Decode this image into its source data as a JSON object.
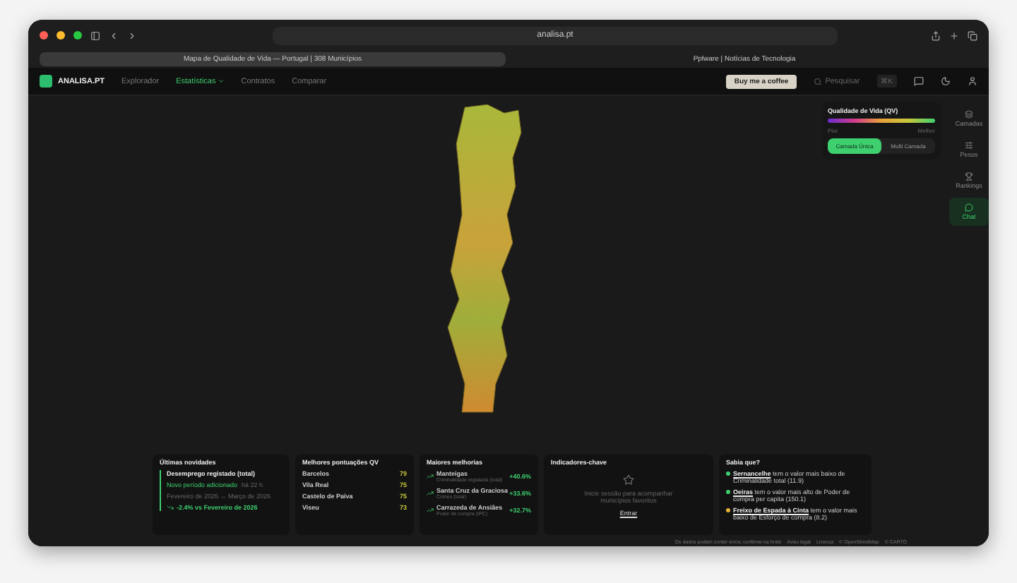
{
  "browser": {
    "address": "analisa.pt",
    "tabs": [
      {
        "title": "Mapa de Qualidade de Vida — Portugal | 308 Municípios",
        "selected": true
      },
      {
        "title": "Pplware | Notícias de Tecnologia",
        "selected": false
      }
    ]
  },
  "app": {
    "logo": "ANALISA.PT",
    "nav": [
      {
        "label": "Explorador",
        "selected": false,
        "dropdown": false
      },
      {
        "label": "Estatísticas",
        "selected": true,
        "dropdown": true
      },
      {
        "label": "Contratos",
        "selected": false,
        "dropdown": false
      },
      {
        "label": "Comparar",
        "selected": false,
        "dropdown": false
      }
    ],
    "coffee": "Buy me a coffee",
    "search": {
      "placeholder": "Pesquisar",
      "shortcut": "⌘K"
    }
  },
  "legend": {
    "title": "Qualidade de Vida (QV)",
    "low": "Pior",
    "high": "Melhor",
    "modes": [
      {
        "label": "Camada Única",
        "selected": true
      },
      {
        "label": "Multi Camada",
        "selected": false
      }
    ]
  },
  "rail": [
    {
      "label": "Camadas",
      "selected": false
    },
    {
      "label": "Pesos",
      "selected": false
    },
    {
      "label": "Rankings",
      "selected": false
    },
    {
      "label": "Chat",
      "selected": true
    }
  ],
  "news": {
    "title": "Últimas novidades",
    "indicator": "Desemprego registado (total)",
    "added": "Novo período adicionado",
    "age": "há 22 h",
    "period": "Fevereiro de 2026 → Março de 2026",
    "change": "-2.4% vs Fevereiro de 2026"
  },
  "best": {
    "title": "Melhores pontuações QV",
    "rows": [
      {
        "name": "Barcelos",
        "score": "79"
      },
      {
        "name": "Vila Real",
        "score": "75"
      },
      {
        "name": "Castelo de Paiva",
        "score": "75"
      },
      {
        "name": "Viseu",
        "score": "73"
      }
    ]
  },
  "improvements": {
    "title": "Maiores melhorias",
    "rows": [
      {
        "name": "Manteigas",
        "metric": "Criminalidade registada (total)",
        "change": "+40.6%"
      },
      {
        "name": "Santa Cruz da Graciosa",
        "metric": "Crimes (total)",
        "change": "+33.6%"
      },
      {
        "name": "Carrazeda de Ansiães",
        "metric": "Poder de compra (IPC)",
        "change": "+32.7%"
      }
    ]
  },
  "key": {
    "title": "Indicadores-chave",
    "message": "Inicie sessão para acompanhar municípios favoritos",
    "action": "Entrar"
  },
  "facts": {
    "title": "Sabia que?",
    "items": [
      {
        "place": "Sernancelhe",
        "text": "tem o valor mais baixo de Criminalidade total (11.9)",
        "color": "#3ecf6e"
      },
      {
        "place": "Oeiras",
        "text": "tem o valor mais alto de Poder de compra per capita (150.1)",
        "color": "#3ecf6e"
      },
      {
        "place": "Freixo de Espada à Cinta",
        "text": "tem o valor mais baixo de Esforço de compra (8.2)",
        "color": "#e8b23a"
      }
    ]
  },
  "footer": [
    "Os dados podem conter erros; confirme na fonte",
    "Aviso legal",
    "Licença",
    "© OpenStreetMap",
    "© CARTO"
  ]
}
